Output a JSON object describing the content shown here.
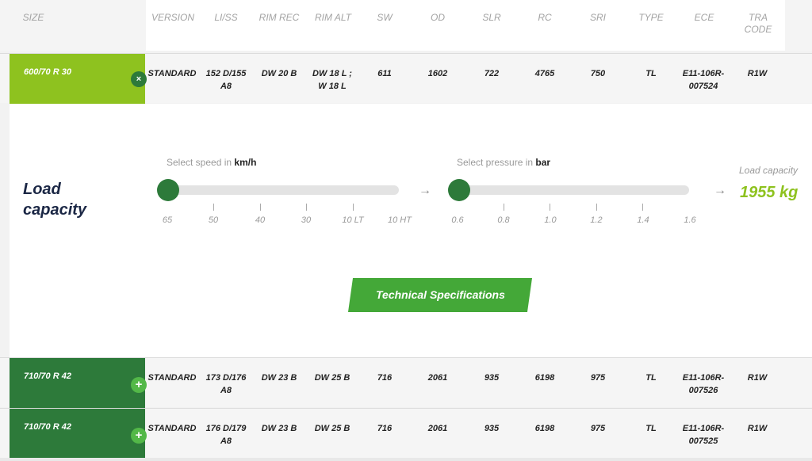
{
  "header": {
    "size": "SIZE",
    "version": "VERSION",
    "li_ss": "LI/SS",
    "rim_rec": "RIM REC",
    "rim_alt": "RIM ALT",
    "sw": "SW",
    "od": "OD",
    "slr": "SLR",
    "rc": "RC",
    "sri": "SRI",
    "type": "TYPE",
    "ece": "ECE",
    "tra_code": "TRA CODE"
  },
  "rows": [
    {
      "size": "600/70 R 30",
      "toggle_icon": "×",
      "version": "STANDARD",
      "li_ss": "152 D/155 A8",
      "rim_rec": "DW 20 B",
      "rim_alt": "DW 18 L ; W 18 L",
      "sw": "611",
      "od": "1602",
      "slr": "722",
      "rc": "4765",
      "sri": "750",
      "type": "TL",
      "ece": "E11-106R-007524",
      "tra": "R1W"
    },
    {
      "size": "710/70 R 42",
      "toggle_icon": "+",
      "version": "STANDARD",
      "li_ss": "173 D/176 A8",
      "rim_rec": "DW 23 B",
      "rim_alt": "DW 25 B",
      "sw": "716",
      "od": "2061",
      "slr": "935",
      "rc": "6198",
      "sri": "975",
      "type": "TL",
      "ece": "E11-106R-007526",
      "tra": "R1W"
    },
    {
      "size": "710/70 R 42",
      "toggle_icon": "+",
      "version": "STANDARD",
      "li_ss": "176 D/179 A8",
      "rim_rec": "DW 23 B",
      "rim_alt": "DW 25 B",
      "sw": "716",
      "od": "2061",
      "slr": "935",
      "rc": "6198",
      "sri": "975",
      "type": "TL",
      "ece": "E11-106R-007525",
      "tra": "R1W"
    }
  ],
  "load_panel": {
    "title": "Load capacity",
    "speed": {
      "caption_prefix": "Select speed in",
      "unit": "km/h",
      "ticks": [
        "65",
        "50",
        "40",
        "30",
        "10 LT",
        "10 HT"
      ],
      "selected_index": 0
    },
    "pressure": {
      "caption_prefix": "Select pressure in",
      "unit": "bar",
      "ticks": [
        "0.6",
        "0.8",
        "1.0",
        "1.2",
        "1.4",
        "1.6"
      ],
      "selected_index": 0
    },
    "arrow": "→",
    "result_caption": "Load capacity",
    "result_value": "1955 kg",
    "tech_button": "Technical Specifications"
  },
  "colors": {
    "active_green": "#8ec21f",
    "dark_green": "#2d7a3a",
    "button_green": "#44a838",
    "title_navy": "#1b2745"
  }
}
